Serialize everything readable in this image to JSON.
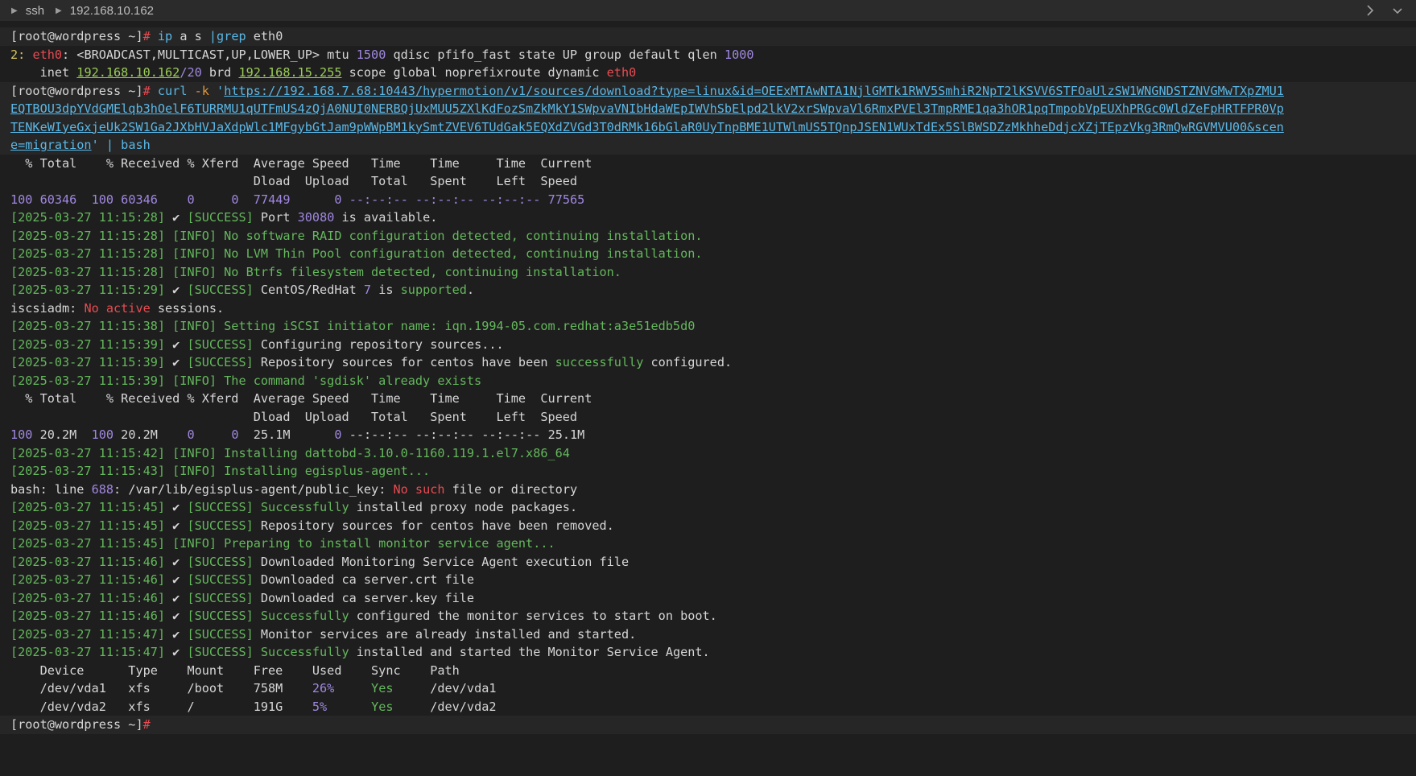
{
  "titlebar": {
    "crumbs": [
      "ssh",
      "192.168.10.162"
    ]
  },
  "lines": {
    "l1": {
      "prompt": "[root@wordpress ~]",
      "hash": "#",
      "cmd1": " ip",
      "cmd2": " a s ",
      "pipe": "|grep",
      "cmd3": " eth0"
    },
    "l2": {
      "num": "2:",
      "dev": " eth0",
      "rest": ": <BROADCAST,MULTICAST,UP,LOWER_UP> mtu ",
      "mtu": "1500",
      "rest2": " qdisc pfifo_fast state UP group default qlen ",
      "qlen": "1000"
    },
    "l3": {
      "pre": "    inet ",
      "ip": "192.168.10.162",
      "mask": "/20",
      "brd": " brd ",
      "bip": "192.168.15.255",
      "rest": " scope global noprefixroute dynamic ",
      "dev": "eth0"
    },
    "l4": {
      "prompt": "[root@wordpress ~]",
      "hash": "#",
      "cmd": " curl",
      "flag": " -k",
      "q": " '",
      "url": "https://192.168.7.68:10443/hypermotion/v1/sources/download?type=linux&id=OEExMTAwNTA1NjlGMTk1RWV5SmhiR2NpT2lKSVV6STFOaUlzSW1WNGNDSTZNVGMwTXpZMU1"
    },
    "l5": {
      "url": "EQTBOU3dpYVdGMElqb3hOelF6TURRMU1qUTFmUS4zQjA0NUI0NERBQjUxMUU5ZXlKdFozSmZkMkY1SWpvaVNIbHdaWEpIWVhSbElpd2lkV2xrSWpvaVl6RmxPVEl3TmpRME1qa3hOR1pqTmpobVpEUXhPRGc0WldZeFpHRTFPR0Vp"
    },
    "l6": {
      "url": "TENKeWIyeGxjeUk2SW1Ga2JXbHVJaXdpWlc1MFgybGtJam9pWWpBM1kySmtZVEV6TUdGak5EQXdZVGd3T0dRMk16bGlaR0UyTnpBME1UTWlmUS5TQnpJSEN1WUxTdEx5SlBWSDZzMkhheDdjcXZjTEpzVkg3RmQwRGVMVU00&scen"
    },
    "l7": {
      "url": "e=migration",
      "q": "'",
      "rest": " | bash"
    },
    "hdr1": "  % Total    % Received % Xferd  Average Speed   Time    Time     Time  Current",
    "hdr2": "                                 Dload  Upload   Total   Spent    Left  Speed",
    "p1": {
      "a": "100",
      "b": " 60346  ",
      "c": "100",
      "d": " 60346    ",
      "e": "0",
      "f": "     ",
      "g": "0",
      "h": "  ",
      "i": "77449",
      "j": "      ",
      "k": "0",
      "l": " --:--:-- --:--:-- --:--:-- ",
      "m": "77565"
    },
    "s1": {
      "ts": "[2025-03-27 11:15:28]",
      "chk": " ✔ ",
      "tag": "[SUCCESS]",
      "t1": " Port ",
      "n": "30080",
      "t2": " is available."
    },
    "i1": "[2025-03-27 11:15:28] [INFO] No software RAID configuration detected, continuing installation.",
    "i2": "[2025-03-27 11:15:28] [INFO] No LVM Thin Pool configuration detected, continuing installation.",
    "i3": "[2025-03-27 11:15:28] [INFO] No Btrfs filesystem detected, continuing installation.",
    "s2": {
      "ts": "[2025-03-27 11:15:29]",
      "chk": " ✔ ",
      "tag": "[SUCCESS]",
      "t1": " CentOS/RedHat ",
      "n": "7",
      "t2": " is ",
      "ok": "supported",
      "t3": "."
    },
    "e1": {
      "a": "iscsiadm: ",
      "b": "No active",
      "c": " sessions."
    },
    "i4": "[2025-03-27 11:15:38] [INFO] Setting iSCSI initiator name: iqn.1994-05.com.redhat:a3e51edb5d0",
    "s3": {
      "ts": "[2025-03-27 11:15:39]",
      "chk": " ✔ ",
      "tag": "[SUCCESS]",
      "t1": " Configuring repository sources..."
    },
    "s4": {
      "ts": "[2025-03-27 11:15:39]",
      "chk": " ✔ ",
      "tag": "[SUCCESS]",
      "t1": " Repository sources for centos have been ",
      "ok": "successfully",
      "t2": " configured."
    },
    "i5": "[2025-03-27 11:15:39] [INFO] The command 'sgdisk' already exists",
    "hdr3": "  % Total    % Received % Xferd  Average Speed   Time    Time     Time  Current",
    "hdr4": "                                 Dload  Upload   Total   Spent    Left  Speed",
    "p2": {
      "a": "100",
      "b": " 20.2M  ",
      "c": "100",
      "d": " 20.2M    ",
      "e": "0",
      "f": "     ",
      "g": "0",
      "h": "  ",
      "i": "25.1M",
      "j": "      ",
      "k": "0",
      "l": " --:--:-- --:--:-- --:--:-- ",
      "m": "25.1M"
    },
    "i6": "[2025-03-27 11:15:42] [INFO] Installing dattobd-3.10.0-1160.119.1.el7.x86_64",
    "i7": "[2025-03-27 11:15:43] [INFO] Installing egisplus-agent...",
    "e2": {
      "a": "bash: line ",
      "n": "688",
      "b": ": /var/lib/egisplus-agent/public_key: ",
      "c": "No such",
      "d": " file or directory"
    },
    "s5": {
      "ts": "[2025-03-27 11:15:45]",
      "chk": " ✔ ",
      "tag": "[SUCCESS]",
      "ok": " Successfully",
      "t1": " installed proxy node packages."
    },
    "s6": {
      "ts": "[2025-03-27 11:15:45]",
      "chk": " ✔ ",
      "tag": "[SUCCESS]",
      "t1": " Repository sources for centos have been removed."
    },
    "i8": "[2025-03-27 11:15:45] [INFO] Preparing to install monitor service agent...",
    "s7": {
      "ts": "[2025-03-27 11:15:46]",
      "chk": " ✔ ",
      "tag": "[SUCCESS]",
      "t1": " Downloaded Monitoring Service Agent execution file"
    },
    "s8": {
      "ts": "[2025-03-27 11:15:46]",
      "chk": " ✔ ",
      "tag": "[SUCCESS]",
      "t1": " Downloaded ca server.crt file"
    },
    "s9": {
      "ts": "[2025-03-27 11:15:46]",
      "chk": " ✔ ",
      "tag": "[SUCCESS]",
      "t1": " Downloaded ca server.key file"
    },
    "s10": {
      "ts": "[2025-03-27 11:15:46]",
      "chk": " ✔ ",
      "tag": "[SUCCESS]",
      "ok": " Successfully",
      "t1": " configured the monitor services to start on boot."
    },
    "s11": {
      "ts": "[2025-03-27 11:15:47]",
      "chk": " ✔ ",
      "tag": "[SUCCESS]",
      "t1": " Monitor services are already installed and started."
    },
    "s12": {
      "ts": "[2025-03-27 11:15:47]",
      "chk": " ✔ ",
      "tag": "[SUCCESS]",
      "ok": " Successfully",
      "t1": " installed and started the Monitor Service Agent."
    },
    "dhdr": "    Device      Type    Mount    Free    Used    Sync    Path",
    "d1": {
      "a": "    /dev/vda1   xfs     /boot    758M    ",
      "used": "26%",
      "b": "     ",
      "sync": "Yes",
      "c": "     /dev/vda1"
    },
    "d2": {
      "a": "    /dev/vda2   xfs     /        191G    ",
      "used": "5%",
      "b": "      ",
      "sync": "Yes",
      "c": "     /dev/vda2"
    },
    "last": {
      "prompt": "[root@wordpress ~]",
      "hash": "#"
    }
  }
}
